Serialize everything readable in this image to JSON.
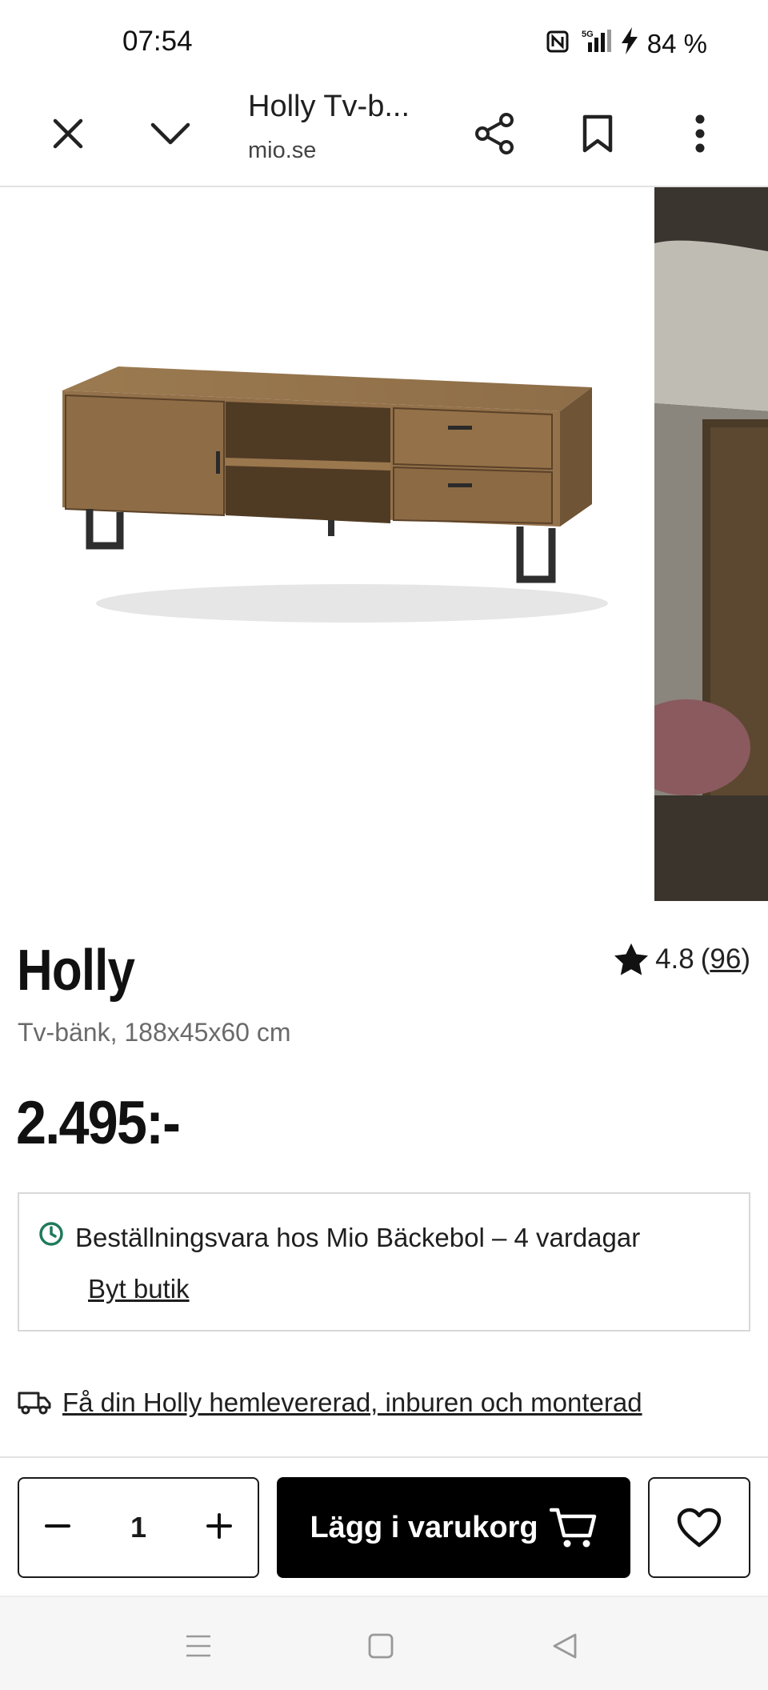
{
  "status_bar": {
    "time": "07:54",
    "battery": "84 %"
  },
  "browser": {
    "page_title": "Holly Tv-b...",
    "url": "mio.se"
  },
  "product": {
    "name": "Holly",
    "subtitle": "Tv-bänk, 188x45x60 cm",
    "price": "2.495:-",
    "rating": "4.8",
    "review_count_open": "(",
    "review_count": "96",
    "review_count_close": ")"
  },
  "stock": {
    "text": "Beställningsvara hos Mio Bäckebol – 4 vardagar",
    "change_store": "Byt butik"
  },
  "delivery": {
    "text": "Få din Holly hemlevererad, inburen och monterad"
  },
  "cart": {
    "quantity": "1",
    "add_label": "Lägg i varukorg"
  },
  "colors": {
    "accent_green": "#1f7a5a",
    "button_black": "#000000"
  }
}
